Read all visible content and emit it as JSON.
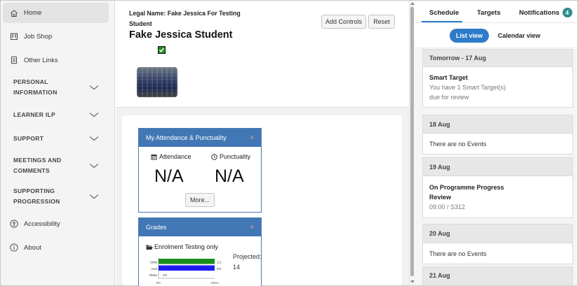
{
  "sidebar": {
    "items": [
      {
        "label": "Home",
        "icon": "home-icon"
      },
      {
        "label": "Job Shop",
        "icon": "building-icon"
      },
      {
        "label": "Other Links",
        "icon": "document-icon"
      }
    ],
    "sections": [
      {
        "label": "PERSONAL INFORMATION"
      },
      {
        "label": "LEARNER ILP"
      },
      {
        "label": "SUPPORT"
      },
      {
        "label": "MEETINGS AND COMMENTS"
      },
      {
        "label": "SUPPORTING PROGRESSION"
      }
    ],
    "footer_items": [
      {
        "label": "Accessibility",
        "icon": "accessibility-icon"
      },
      {
        "label": "About",
        "icon": "info-icon"
      }
    ]
  },
  "header": {
    "legal_name": "Legal Name: Fake Jessica For Testing Student",
    "student_name": "Fake Jessica Student",
    "add_controls_label": "Add Controls",
    "reset_label": "Reset"
  },
  "attendance_card": {
    "title": "My Attendance & Punctuality",
    "close": "×",
    "attendance_label": "Attendance",
    "punctuality_label": "Punctuality",
    "attendance_value": "N/A",
    "punctuality_value": "N/A",
    "more_label": "More..."
  },
  "grades_card": {
    "title": "Grades",
    "close": "×",
    "enrolment": "Enrolment Testing only",
    "projected": "Projected: 14",
    "mini_chart": {
      "rows": [
        {
          "label": "Units",
          "value_label": "1/1",
          "value": 1.0,
          "color": "#1a8f1a"
        },
        {
          "label": "Asst",
          "value_label": "6/6",
          "value": 1.0,
          "color": "#1c1cf0"
        },
        {
          "label": "Tasks",
          "value_label": "0/0",
          "value": 0.0,
          "color": "#1a8f1a"
        }
      ],
      "axis_min": "0%",
      "axis_max": "100%"
    }
  },
  "right_panel": {
    "tabs": [
      {
        "label": "Schedule"
      },
      {
        "label": "Targets"
      },
      {
        "label": "Notifications",
        "badge": "4"
      }
    ],
    "views": {
      "list": "List view",
      "calendar": "Calendar view"
    },
    "days": [
      {
        "header": "Tomorrow - 17 Aug",
        "event_title": "Smart Target",
        "event_sub": "You have 1 Smart Target(s) due for review"
      },
      {
        "header": "18 Aug",
        "empty": "There are no Events"
      },
      {
        "header": "19 Aug",
        "event_title": "On Programme Progress Review",
        "event_sub": "09:00 / S312"
      },
      {
        "header": "20 Aug",
        "empty": "There are no Events"
      },
      {
        "header": "21 Aug"
      }
    ]
  }
}
